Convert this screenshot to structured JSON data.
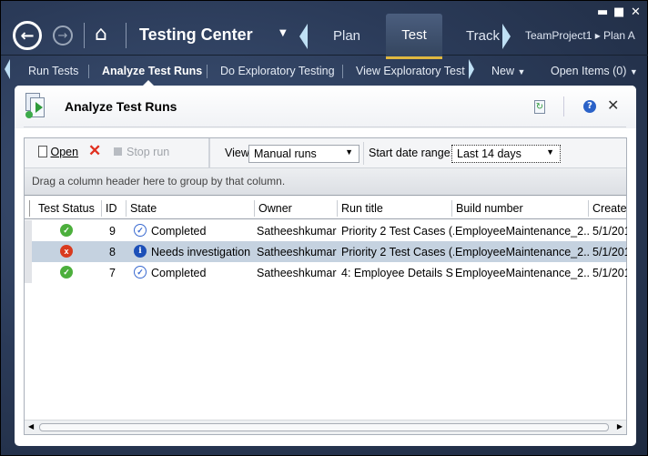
{
  "app": {
    "title": "Testing Center",
    "tabs": [
      "Plan",
      "Test",
      "Track"
    ],
    "active_tab": "Test",
    "breadcrumb": "TeamProject1 ▸ Plan A"
  },
  "nav": {
    "items": [
      "Run Tests",
      "Analyze Test Runs",
      "Do Exploratory Testing",
      "View Exploratory Test S"
    ],
    "active": "Analyze Test Runs",
    "new_label": "New",
    "open_items_label": "Open Items (0)"
  },
  "panel": {
    "title": "Analyze Test Runs"
  },
  "toolbar": {
    "open_label": "Open",
    "stop_label": "Stop run",
    "view_label": "View:",
    "view_value": "Manual runs",
    "date_label": "Start date range:",
    "date_value": "Last 14 days"
  },
  "group_hint": "Drag a column header here to group by that column.",
  "columns": [
    "Test Status",
    "ID",
    "State",
    "Owner",
    "Run title",
    "Build number",
    "Created"
  ],
  "rows": [
    {
      "status": "passed",
      "id": "9",
      "state": "Completed",
      "owner": "Satheeshkumar",
      "title": "Priority 2 Test Cases (...",
      "build": "EmployeeMaintenance_2...",
      "created": "5/1/201"
    },
    {
      "status": "failed",
      "id": "8",
      "state": "Needs investigation",
      "owner": "Satheeshkumar",
      "title": "Priority 2 Test Cases (...",
      "build": "EmployeeMaintenance_2...",
      "created": "5/1/201"
    },
    {
      "status": "passed",
      "id": "7",
      "state": "Completed",
      "owner": "Satheeshkumar",
      "title": "4: Employee Details S...",
      "build": "EmployeeMaintenance_2...",
      "created": "5/1/201"
    }
  ],
  "colors": {
    "passed": "#4caf3c",
    "failed": "#d93a1e",
    "accent": "#e0b840",
    "selected": "#c5d2e0"
  }
}
